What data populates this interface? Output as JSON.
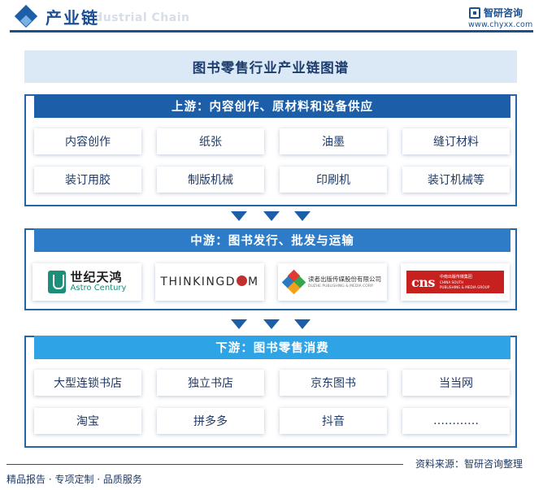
{
  "header": {
    "title": "产业链",
    "subtitle": "Industrial Chain",
    "brand_name": "智研咨询",
    "brand_url": "www.chyxx.com"
  },
  "chart_title": "图书零售行业产业链图谱",
  "upstream": {
    "title": "上游：内容创作、原材料和设备供应",
    "items": [
      "内容创作",
      "纸张",
      "油墨",
      "缝订材料",
      "装订用胶",
      "制版机械",
      "印刷机",
      "装订机械等"
    ]
  },
  "midstream": {
    "title": "中游：图书发行、批发与运输",
    "logos": [
      {
        "name": "astro-century-logo",
        "cn": "世纪天鸿",
        "en": "Astro Century"
      },
      {
        "name": "thinkingdom-logo",
        "text_a": "THINKINGD",
        "text_b": "M"
      },
      {
        "name": "duzhe-logo",
        "cn": "读者出版传媒股份有限公司",
        "en": "DUZHE PUBLISHING & MEDIA CORP."
      },
      {
        "name": "cns-logo",
        "mark": "cns",
        "cn": "中南出版传媒集团",
        "en1": "CHINA SOUTH",
        "en2": "PUBLISHING & MEDIA GROUP"
      }
    ]
  },
  "downstream": {
    "title": "下游：图书零售消费",
    "items": [
      "大型连锁书店",
      "独立书店",
      "京东图书",
      "当当网",
      "淘宝",
      "拼多多",
      "抖音",
      "…………"
    ]
  },
  "footer": {
    "left": "精品报告 · 专项定制 · 品质服务",
    "right": "资料来源：智研咨询整理"
  },
  "colors": {
    "upstream_header": "#1c5ea7",
    "midstream_header": "#2e7cc7",
    "downstream_header": "#2ea4e6",
    "title_band": "#dbe9f6",
    "accent": "#1c4f91"
  }
}
